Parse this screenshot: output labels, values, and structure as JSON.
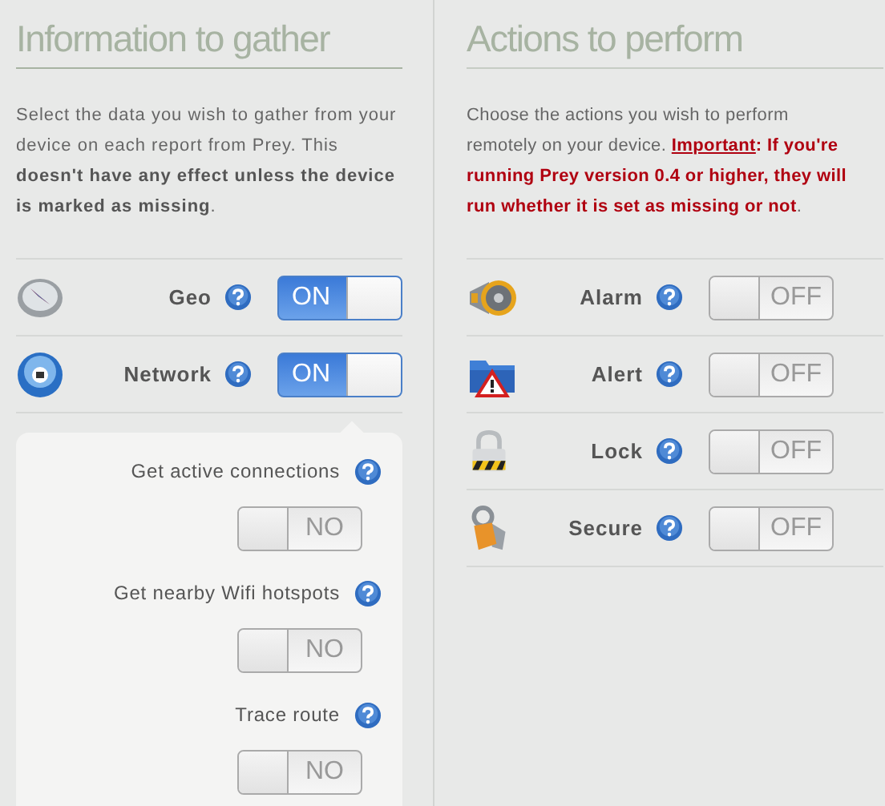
{
  "columns": [
    {
      "title": "Information to gather",
      "description": [
        {
          "kind": "plain",
          "text": "Select the data you wish to gather from your device on each report from Prey. This "
        },
        {
          "kind": "strong",
          "text": "doesn't have any effect unless the device is marked as missing"
        },
        {
          "kind": "plain",
          "text": "."
        }
      ],
      "items": [
        {
          "kind": "compass",
          "label": "Geo",
          "on": true,
          "toggle_text": "ON"
        },
        {
          "kind": "globe",
          "label": "Network",
          "on": true,
          "toggle_text": "ON",
          "expanded": true,
          "options": [
            {
              "label": "Get active connections",
              "on": false,
              "toggle_text": "NO"
            },
            {
              "label": "Get nearby Wifi hotspots",
              "on": false,
              "toggle_text": "NO"
            },
            {
              "label": "Trace route",
              "on": false,
              "toggle_text": "NO"
            }
          ]
        }
      ]
    },
    {
      "title": "Actions to perform",
      "description": [
        {
          "kind": "plain",
          "text": "Choose the actions you wish to perform remotely on your device. "
        },
        {
          "kind": "link",
          "text": "Important"
        },
        {
          "kind": "warning",
          "text": ": If you're running Prey version 0.4 or higher, they will run whether it is set as missing or not"
        },
        {
          "kind": "plain",
          "text": "."
        }
      ],
      "items": [
        {
          "kind": "megaphone",
          "label": "Alarm",
          "on": false,
          "toggle_text": "OFF"
        },
        {
          "kind": "warning-folder",
          "label": "Alert",
          "on": false,
          "toggle_text": "OFF"
        },
        {
          "kind": "padlock",
          "label": "Lock",
          "on": false,
          "toggle_text": "OFF"
        },
        {
          "kind": "keys",
          "label": "Secure",
          "on": false,
          "toggle_text": "OFF"
        }
      ]
    }
  ]
}
